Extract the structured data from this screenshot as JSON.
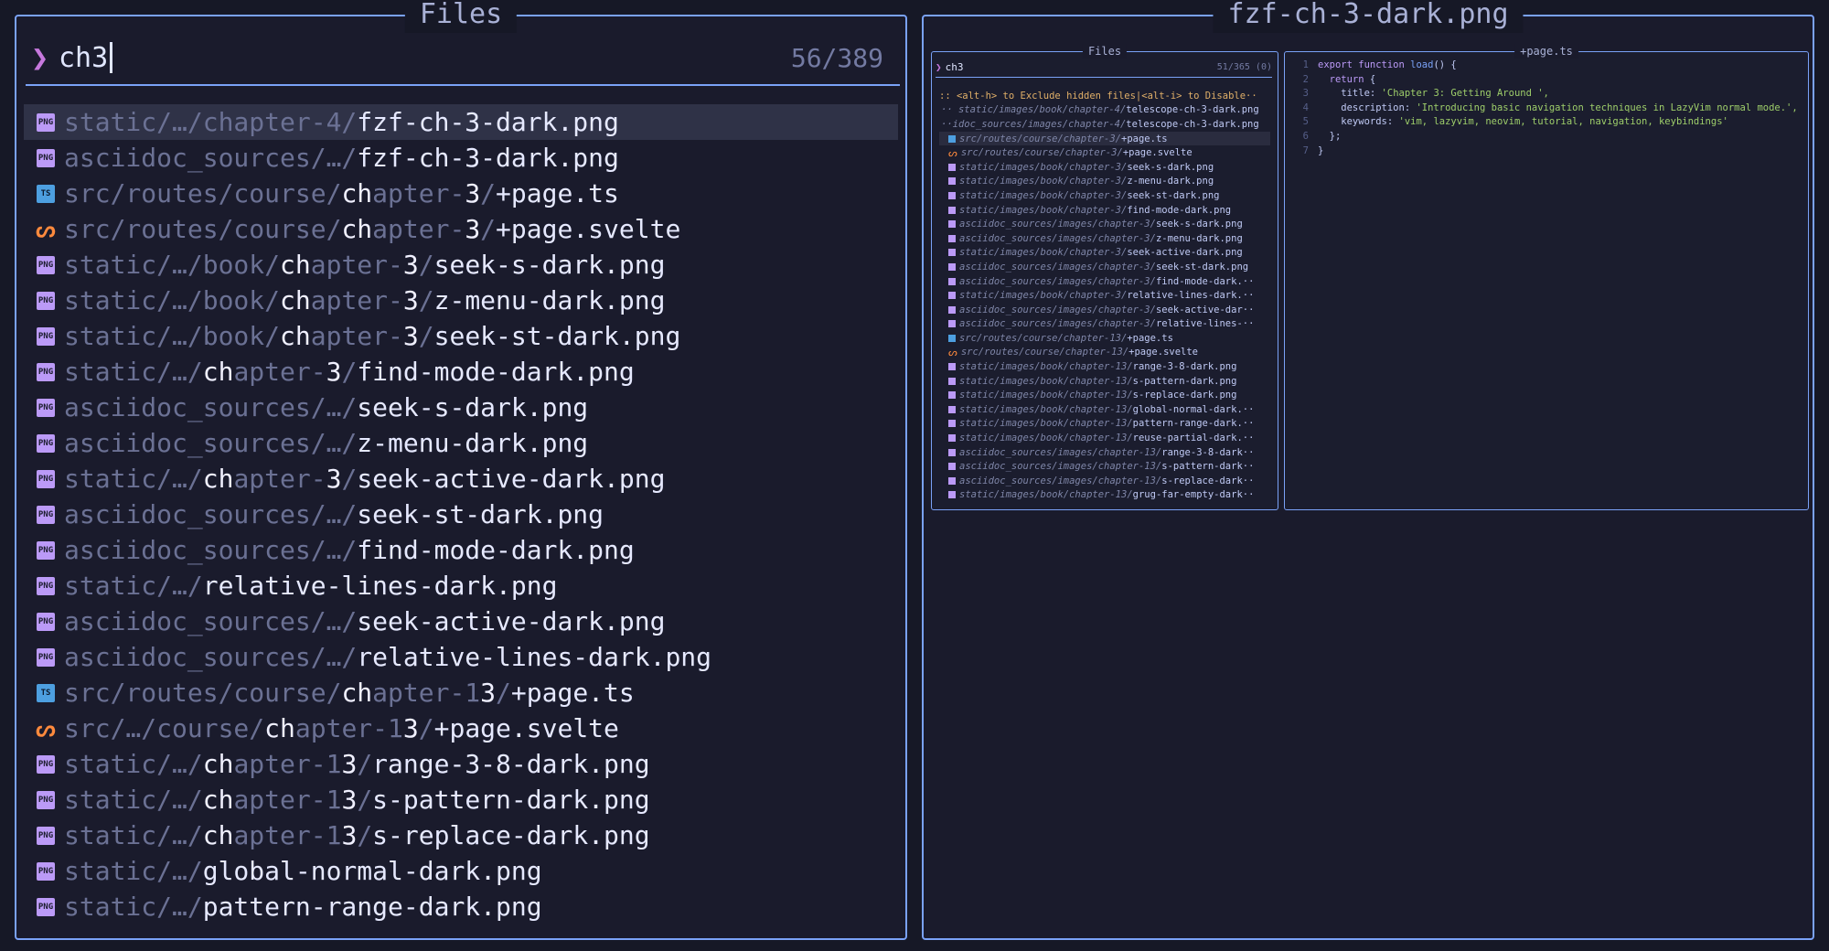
{
  "left": {
    "title": "Files",
    "query": "ch3",
    "count": "56/389",
    "rows": [
      {
        "icon": "png",
        "dir": "static/…/chapter-4/",
        "name": "fzf-ch-3-dark.png",
        "sel": true
      },
      {
        "icon": "png",
        "dir": "asciidoc_sources/…/",
        "name": "fzf-ch-3-dark.png"
      },
      {
        "icon": "ts",
        "dir": "src/routes/course/chapter-3/",
        "name": "+page.ts"
      },
      {
        "icon": "svelte",
        "dir": "src/routes/course/chapter-3/",
        "name": "+page.svelte"
      },
      {
        "icon": "png",
        "dir": "static/…/book/chapter-3/",
        "name": "seek-s-dark.png"
      },
      {
        "icon": "png",
        "dir": "static/…/book/chapter-3/",
        "name": "z-menu-dark.png"
      },
      {
        "icon": "png",
        "dir": "static/…/book/chapter-3/",
        "name": "seek-st-dark.png"
      },
      {
        "icon": "png",
        "dir": "static/…/chapter-3/",
        "name": "find-mode-dark.png"
      },
      {
        "icon": "png",
        "dir": "asciidoc_sources/…/",
        "name": "seek-s-dark.png"
      },
      {
        "icon": "png",
        "dir": "asciidoc_sources/…/",
        "name": "z-menu-dark.png"
      },
      {
        "icon": "png",
        "dir": "static/…/chapter-3/",
        "name": "seek-active-dark.png"
      },
      {
        "icon": "png",
        "dir": "asciidoc_sources/…/",
        "name": "seek-st-dark.png"
      },
      {
        "icon": "png",
        "dir": "asciidoc_sources/…/",
        "name": "find-mode-dark.png"
      },
      {
        "icon": "png",
        "dir": "static/…/",
        "name": "relative-lines-dark.png"
      },
      {
        "icon": "png",
        "dir": "asciidoc_sources/…/",
        "name": "seek-active-dark.png"
      },
      {
        "icon": "png",
        "dir": "asciidoc_sources/…/",
        "name": "relative-lines-dark.png"
      },
      {
        "icon": "ts",
        "dir": "src/routes/course/chapter-13/",
        "name": "+page.ts"
      },
      {
        "icon": "svelte",
        "dir": "src/…/course/chapter-13/",
        "name": "+page.svelte"
      },
      {
        "icon": "png",
        "dir": "static/…/chapter-13/",
        "name": "range-3-8-dark.png"
      },
      {
        "icon": "png",
        "dir": "static/…/chapter-13/",
        "name": "s-pattern-dark.png"
      },
      {
        "icon": "png",
        "dir": "static/…/chapter-13/",
        "name": "s-replace-dark.png"
      },
      {
        "icon": "png",
        "dir": "static/…/",
        "name": "global-normal-dark.png"
      },
      {
        "icon": "png",
        "dir": "static/…/",
        "name": "pattern-range-dark.png"
      }
    ]
  },
  "right": {
    "title": "fzf-ch-3-dark.png",
    "mini_files_title": "Files",
    "mini_query": "ch3",
    "mini_count": "51/365 (0)",
    "mini_hint": ":: <alt-h> to Exclude hidden files|<alt-i> to Disable··",
    "mini_rows": [
      {
        "icon": "none",
        "dir": "·· static/images/book/chapter-4/",
        "name": "telescope-ch-3-dark.png"
      },
      {
        "icon": "none",
        "dir": "··idoc_sources/images/chapter-4/",
        "name": "telescope-ch-3-dark.png"
      },
      {
        "icon": "ts",
        "dir": "src/routes/course/chapter-3/",
        "name": "+page.ts",
        "sel": true
      },
      {
        "icon": "svelte",
        "dir": "src/routes/course/chapter-3/",
        "name": "+page.svelte"
      },
      {
        "icon": "png",
        "dir": "static/images/book/chapter-3/",
        "name": "seek-s-dark.png"
      },
      {
        "icon": "png",
        "dir": "static/images/book/chapter-3/",
        "name": "z-menu-dark.png"
      },
      {
        "icon": "png",
        "dir": "static/images/book/chapter-3/",
        "name": "seek-st-dark.png"
      },
      {
        "icon": "png",
        "dir": "static/images/book/chapter-3/",
        "name": "find-mode-dark.png"
      },
      {
        "icon": "png",
        "dir": "asciidoc_sources/images/chapter-3/",
        "name": "seek-s-dark.png"
      },
      {
        "icon": "png",
        "dir": "asciidoc_sources/images/chapter-3/",
        "name": "z-menu-dark.png"
      },
      {
        "icon": "png",
        "dir": "static/images/book/chapter-3/",
        "name": "seek-active-dark.png"
      },
      {
        "icon": "png",
        "dir": "asciidoc_sources/images/chapter-3/",
        "name": "seek-st-dark.png"
      },
      {
        "icon": "png",
        "dir": "asciidoc_sources/images/chapter-3/",
        "name": "find-mode-dark.··"
      },
      {
        "icon": "png",
        "dir": "static/images/book/chapter-3/",
        "name": "relative-lines-dark.··"
      },
      {
        "icon": "png",
        "dir": "asciidoc_sources/images/chapter-3/",
        "name": "seek-active-dar··"
      },
      {
        "icon": "png",
        "dir": "asciidoc_sources/images/chapter-3/",
        "name": "relative-lines-··"
      },
      {
        "icon": "ts",
        "dir": "src/routes/course/chapter-13/",
        "name": "+page.ts"
      },
      {
        "icon": "svelte",
        "dir": "src/routes/course/chapter-13/",
        "name": "+page.svelte"
      },
      {
        "icon": "png",
        "dir": "static/images/book/chapter-13/",
        "name": "range-3-8-dark.png"
      },
      {
        "icon": "png",
        "dir": "static/images/book/chapter-13/",
        "name": "s-pattern-dark.png"
      },
      {
        "icon": "png",
        "dir": "static/images/book/chapter-13/",
        "name": "s-replace-dark.png"
      },
      {
        "icon": "png",
        "dir": "static/images/book/chapter-13/",
        "name": "global-normal-dark.··"
      },
      {
        "icon": "png",
        "dir": "static/images/book/chapter-13/",
        "name": "pattern-range-dark.··"
      },
      {
        "icon": "png",
        "dir": "static/images/book/chapter-13/",
        "name": "reuse-partial-dark.··"
      },
      {
        "icon": "png",
        "dir": "asciidoc_sources/images/chapter-13/",
        "name": "range-3-8-dark··"
      },
      {
        "icon": "png",
        "dir": "asciidoc_sources/images/chapter-13/",
        "name": "s-pattern-dark··"
      },
      {
        "icon": "png",
        "dir": "asciidoc_sources/images/chapter-13/",
        "name": "s-replace-dark··"
      },
      {
        "icon": "png",
        "dir": "static/images/book/chapter-13/",
        "name": "grug-far-empty-dark··"
      }
    ],
    "code_title": "+page.ts",
    "code_lines": [
      {
        "n": "1",
        "parts": [
          [
            "kw",
            "export function "
          ],
          [
            "fn",
            "load"
          ],
          [
            "prop",
            "() {"
          ]
        ]
      },
      {
        "n": "2",
        "parts": [
          [
            "kw",
            "  return "
          ],
          [
            "prop",
            "{"
          ]
        ]
      },
      {
        "n": "3",
        "parts": [
          [
            "prop",
            "    title: "
          ],
          [
            "str",
            "'Chapter 3: Getting Around ',"
          ]
        ]
      },
      {
        "n": "4",
        "parts": [
          [
            "prop",
            "    description: "
          ],
          [
            "str",
            "'Introducing basic navigation techniques in LazyVim normal mode.',"
          ]
        ]
      },
      {
        "n": "5",
        "parts": [
          [
            "prop",
            "    keywords: "
          ],
          [
            "str",
            "'vim, lazyvim, neovim, tutorial, navigation, keybindings'"
          ]
        ]
      },
      {
        "n": "6",
        "parts": [
          [
            "prop",
            "  };"
          ]
        ]
      },
      {
        "n": "7",
        "parts": [
          [
            "prop",
            "}"
          ]
        ]
      }
    ]
  },
  "colors": {
    "accent": "#7aa2f7",
    "prompt": "#c678dd",
    "png_icon": "#bb9af7",
    "ts_icon": "#4d9fe0",
    "svelte_icon": "#ff8a3d"
  }
}
